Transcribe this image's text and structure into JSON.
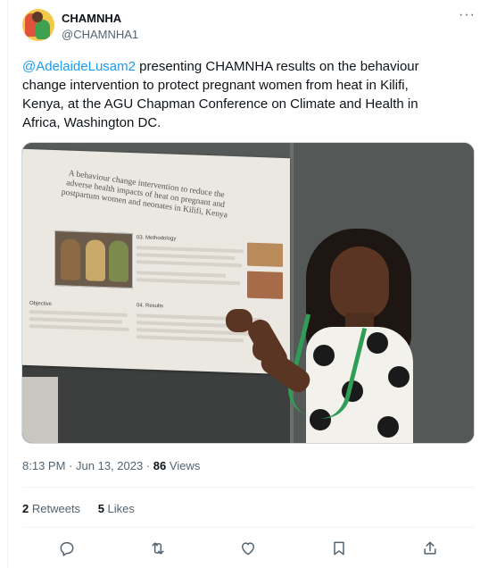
{
  "author": {
    "name": "CHAMNHA",
    "handle": "@CHAMNHA1"
  },
  "more_label": "···",
  "tweet": {
    "mention": "@AdelaideLusam2",
    "text": " presenting CHAMNHA results on the behaviour change intervention to protect pregnant women from heat in Kilifi, Kenya, at the AGU Chapman Conference on Climate and Health in Africa, Washington DC."
  },
  "media": {
    "poster_title": "A behaviour change intervention to reduce the adverse health impacts of heat on pregnant and postpartum women and neonates in Kilifi, Kenya",
    "poster_section_methodology": "03. Methodology",
    "poster_section_results": "04. Results",
    "poster_section_objective": "Objective"
  },
  "meta": {
    "time": "8:13 PM",
    "separator": "·",
    "date": "Jun 13, 2023",
    "views_count": "86",
    "views_label": "Views"
  },
  "stats": {
    "retweets_count": "2",
    "retweets_label": "Retweets",
    "likes_count": "5",
    "likes_label": "Likes"
  },
  "icons": {
    "reply": "reply-icon",
    "retweet": "retweet-icon",
    "like": "heart-icon",
    "bookmark": "bookmark-icon",
    "share": "share-icon"
  },
  "colors": {
    "accent": "#1d9bf0",
    "text": "#0f1419",
    "secondary": "#536471"
  }
}
